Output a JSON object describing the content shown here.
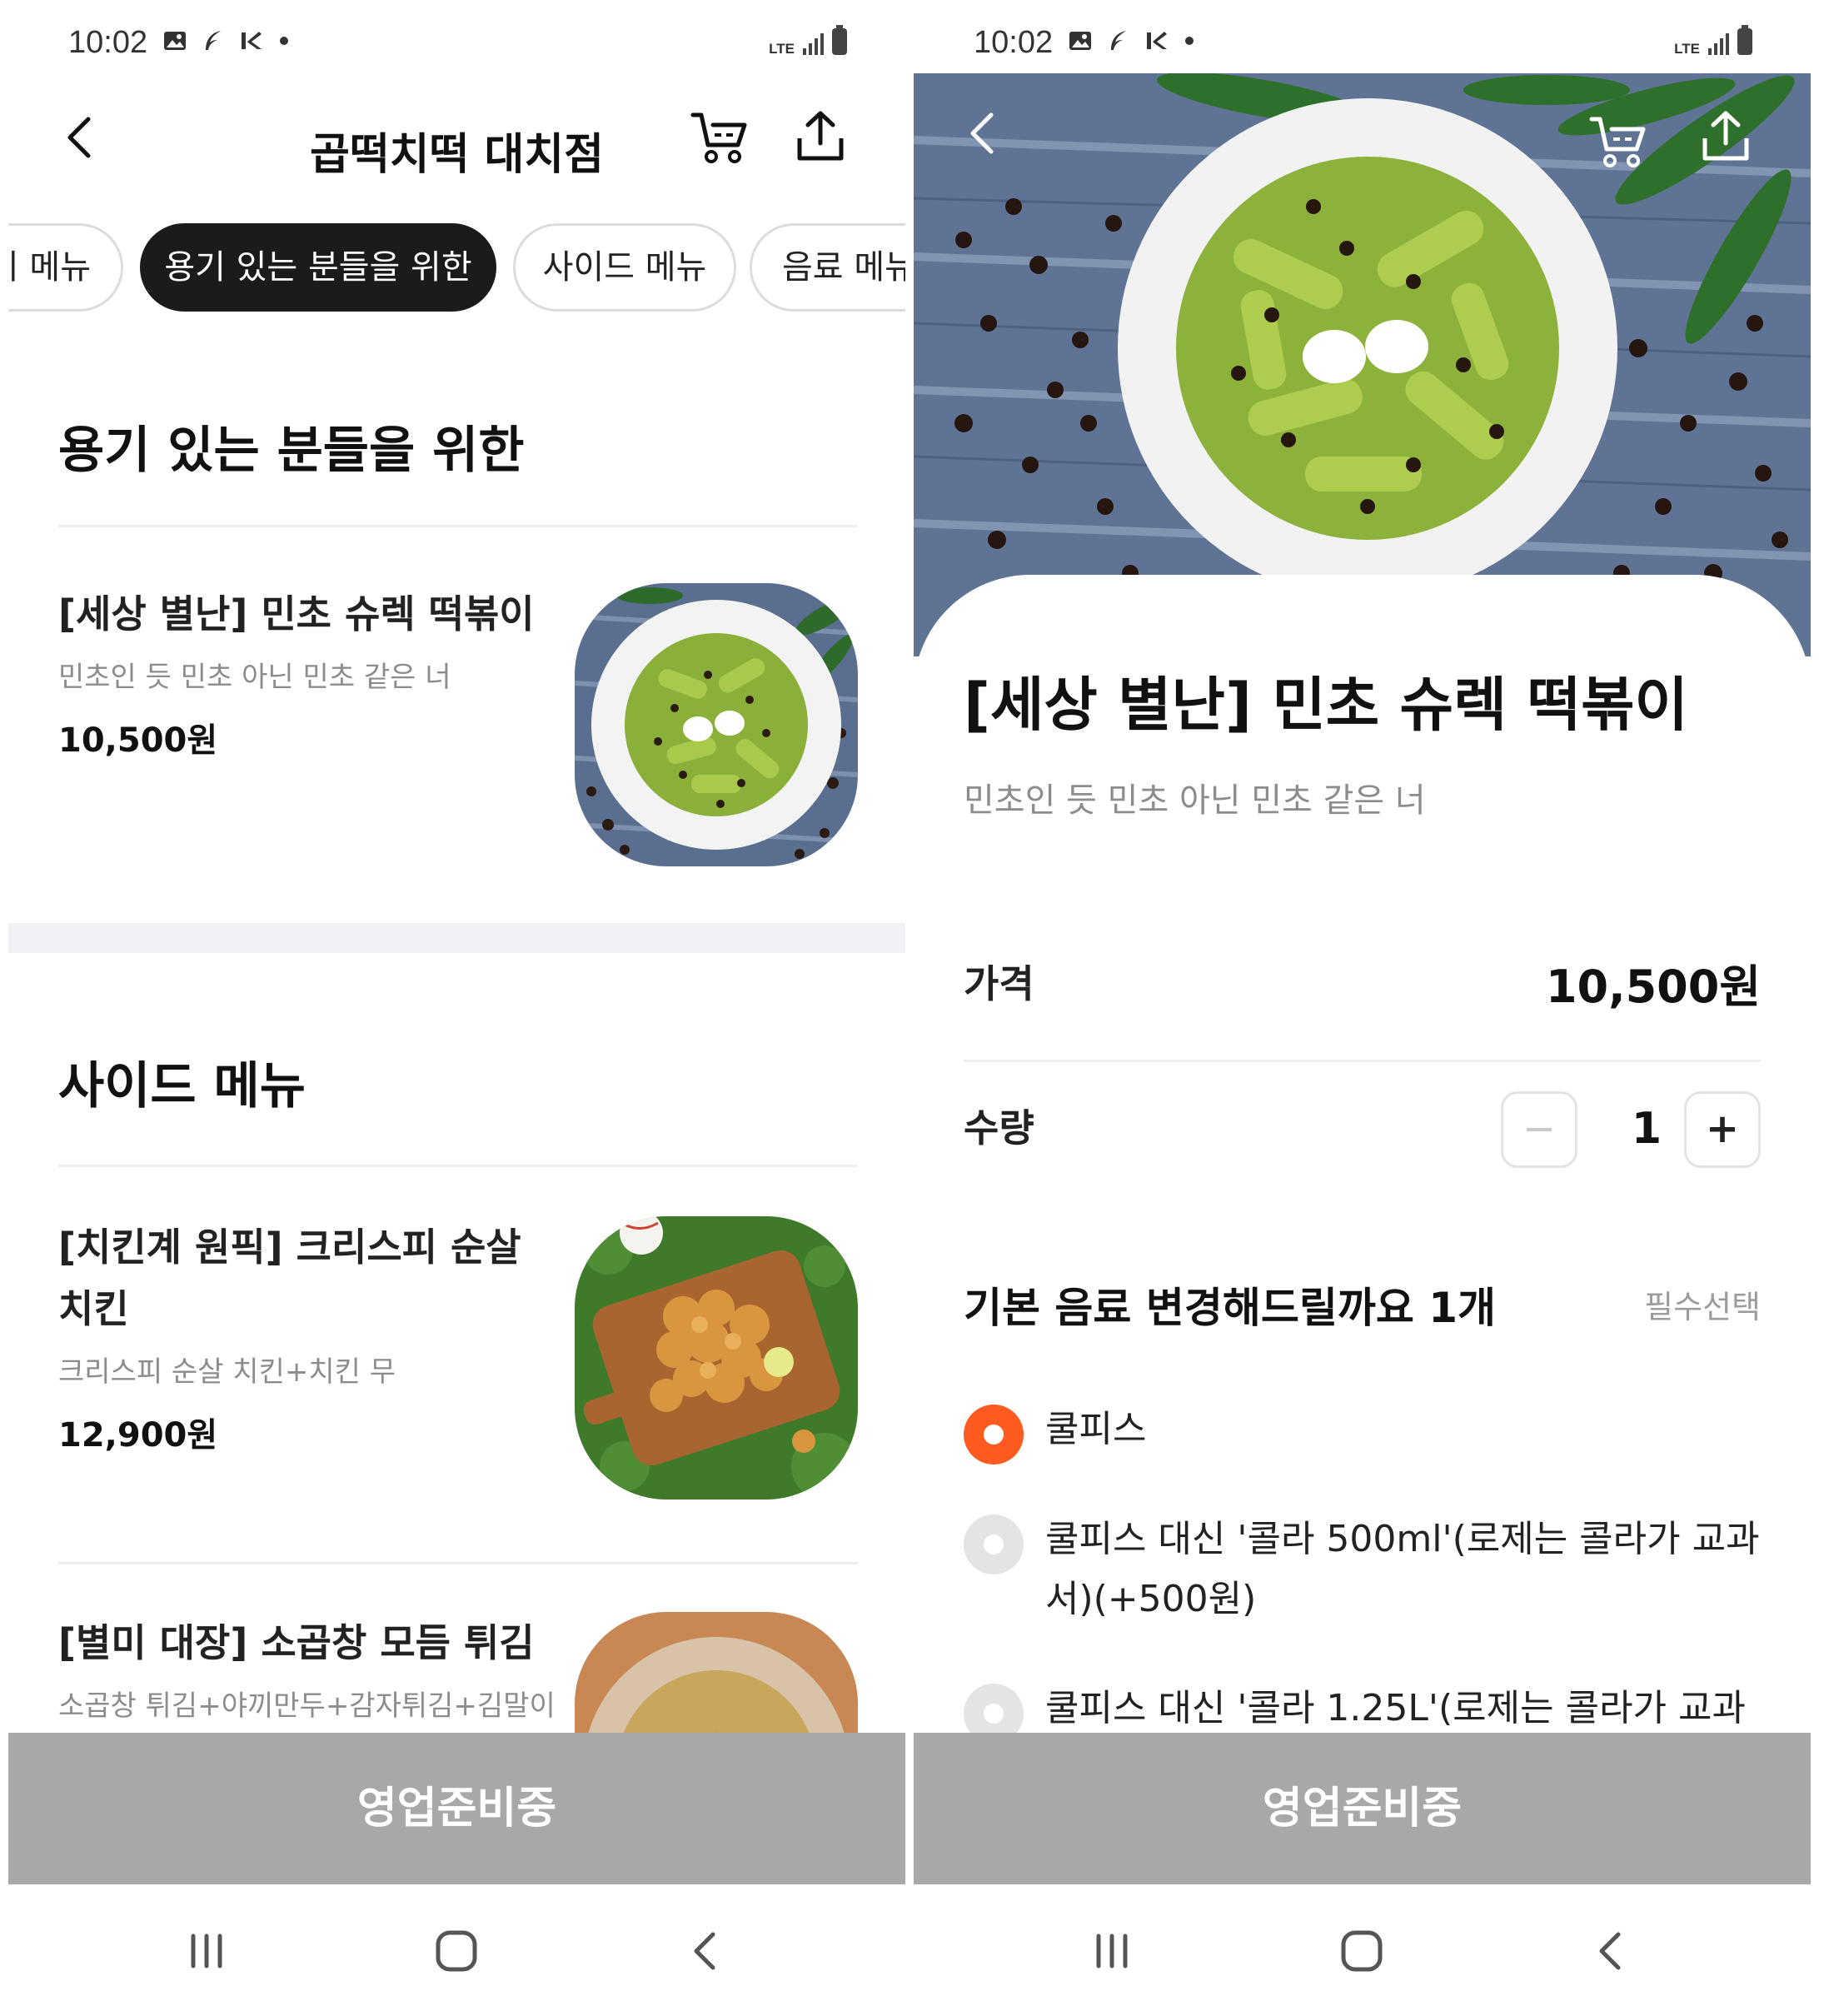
{
  "status_bar": {
    "time": "10:02",
    "network": "LTE"
  },
  "list_screen": {
    "store_title": "곱떡치떡 대치점",
    "tabs": [
      {
        "label": "이 메뉴"
      },
      {
        "label": "용기 있는 분들을 위한"
      },
      {
        "label": "사이드 메뉴"
      },
      {
        "label": "음료 메뉴"
      }
    ],
    "sections": [
      {
        "title": "용기 있는 분들을 위한",
        "items": [
          {
            "name": "[세상 별난] 민초 슈렉 떡볶이",
            "desc": "민초인 듯 민초 아닌 민초 같은 너",
            "price": "10,500원",
            "image": "green-tteokbokki-photo"
          }
        ]
      },
      {
        "title": "사이드 메뉴",
        "items": [
          {
            "name": "[치킨계 원픽] 크리스피 순살 치킨",
            "desc": "크리스피 순살 치킨+치킨 무",
            "price": "12,900원",
            "image": "fried-chicken-photo"
          },
          {
            "name": "[별미 대장] 소곱창 모듬 튀김",
            "desc": "소곱창 튀김+야끼만두+감자튀김+김말이",
            "price": "",
            "image": "fried-intestine-photo"
          }
        ]
      }
    ],
    "cta_label": "영업준비중"
  },
  "detail_screen": {
    "name": "[세상 별난] 민초 슈렉 떡볶이",
    "desc": "민초인 듯 민초 아닌 민초 같은 너",
    "price_label": "가격",
    "price": "10,500원",
    "qty_label": "수량",
    "qty_minus": "−",
    "qty_value": "1",
    "qty_plus": "+",
    "option_group": {
      "title": "기본 음료 변경해드릴까요 1개",
      "required": "필수선택",
      "options": [
        {
          "label": "쿨피스",
          "selected": true
        },
        {
          "label": "쿨피스 대신 '콜라 500ml'(로제는 콜라가 교과서)(+500원)",
          "selected": false
        },
        {
          "label": "쿨피스 대신 '콜라 1.25L'(로제는 콜라가 교과",
          "selected": false
        }
      ]
    },
    "cta_label": "영업준비중"
  },
  "colors": {
    "accent": "#ff5a1f",
    "cta_disabled": "#a8a8a8",
    "active_tab": "#1b1b1b",
    "muted_text": "#8c8c8c"
  },
  "icons": [
    "back-arrow-icon",
    "cart-icon",
    "share-icon",
    "recents-icon",
    "home-icon",
    "nav-back-icon"
  ]
}
